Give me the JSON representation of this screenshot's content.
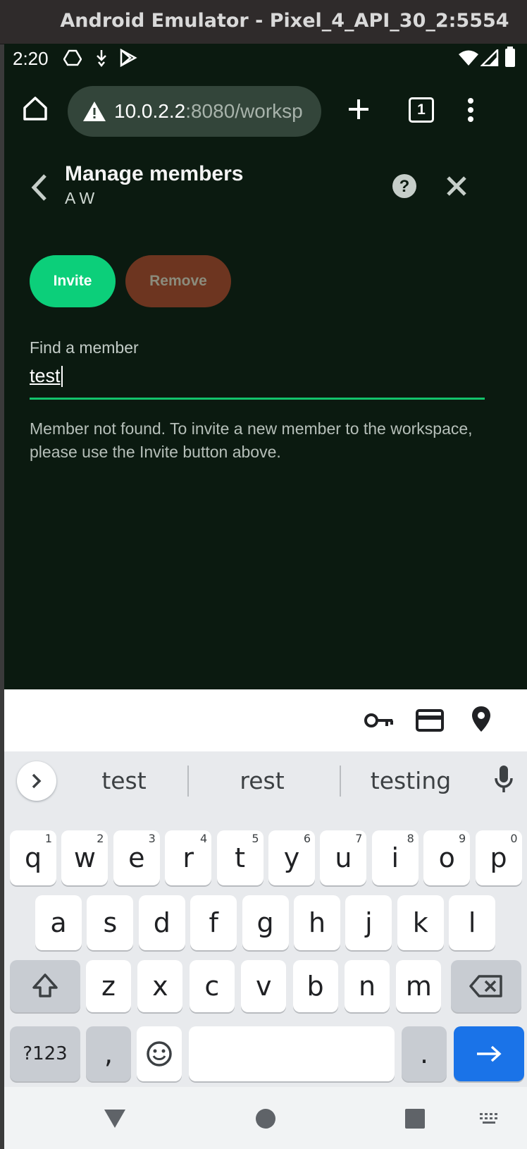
{
  "window": {
    "title": "Android Emulator - Pixel_4_API_30_2:5554"
  },
  "status_bar": {
    "time": "2:20"
  },
  "browser": {
    "url_host": "10.0.2.2",
    "url_rest": ":8080/worksp",
    "tab_count": "1"
  },
  "header": {
    "title": "Manage members",
    "subtitle": "A W"
  },
  "actions": {
    "invite_label": "Invite",
    "remove_label": "Remove"
  },
  "search": {
    "label": "Find a member",
    "value": "test"
  },
  "message": "Member not found. To invite a new member to the workspace, please use the Invite button above.",
  "suggestions": [
    "test",
    "rest",
    "testing"
  ],
  "keyboard": {
    "row1": [
      {
        "k": "q",
        "n": "1"
      },
      {
        "k": "w",
        "n": "2"
      },
      {
        "k": "e",
        "n": "3"
      },
      {
        "k": "r",
        "n": "4"
      },
      {
        "k": "t",
        "n": "5"
      },
      {
        "k": "y",
        "n": "6"
      },
      {
        "k": "u",
        "n": "7"
      },
      {
        "k": "i",
        "n": "8"
      },
      {
        "k": "o",
        "n": "9"
      },
      {
        "k": "p",
        "n": "0"
      }
    ],
    "row2": [
      "a",
      "s",
      "d",
      "f",
      "g",
      "h",
      "j",
      "k",
      "l"
    ],
    "row3": [
      "z",
      "x",
      "c",
      "v",
      "b",
      "n",
      "m"
    ],
    "symbols_label": "?123",
    "comma": ",",
    "period": "."
  }
}
